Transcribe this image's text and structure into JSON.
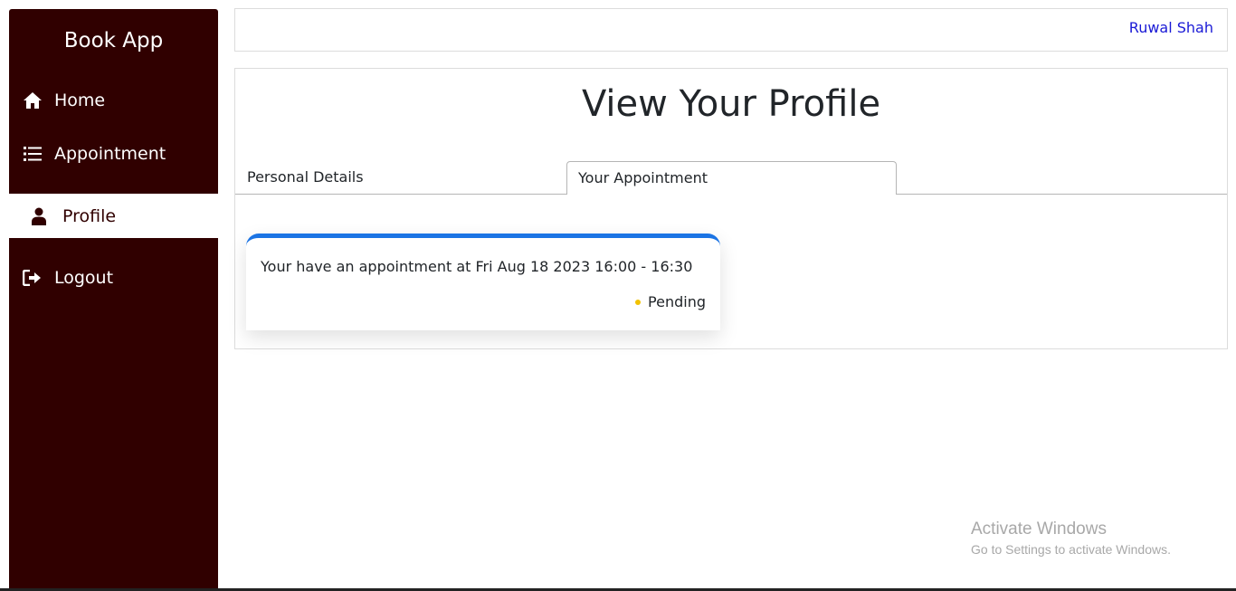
{
  "app": {
    "brand": "Book App"
  },
  "sidebar": {
    "items": [
      {
        "label": "Home",
        "icon": "home-icon"
      },
      {
        "label": "Appointment",
        "icon": "list-icon"
      },
      {
        "label": "Profile",
        "icon": "user-icon",
        "active": true
      },
      {
        "label": "Logout",
        "icon": "logout-icon"
      }
    ]
  },
  "header": {
    "user_name": "Ruwal Shah"
  },
  "main": {
    "title": "View Your Profile",
    "tabs": [
      {
        "label": "Personal Details"
      },
      {
        "label": "Your Appointment",
        "active": true
      }
    ],
    "appointment": {
      "text": "Your have an appointment at Fri Aug 18 2023 16:00 - 16:30",
      "status": "Pending",
      "status_color": "#f2c200",
      "accent_color": "#1b74e4"
    }
  },
  "watermark": {
    "title": "Activate Windows",
    "subtitle": "Go to Settings to activate Windows."
  },
  "colors": {
    "sidebar_bg": "#300000",
    "user_link": "#1a1ad6"
  }
}
